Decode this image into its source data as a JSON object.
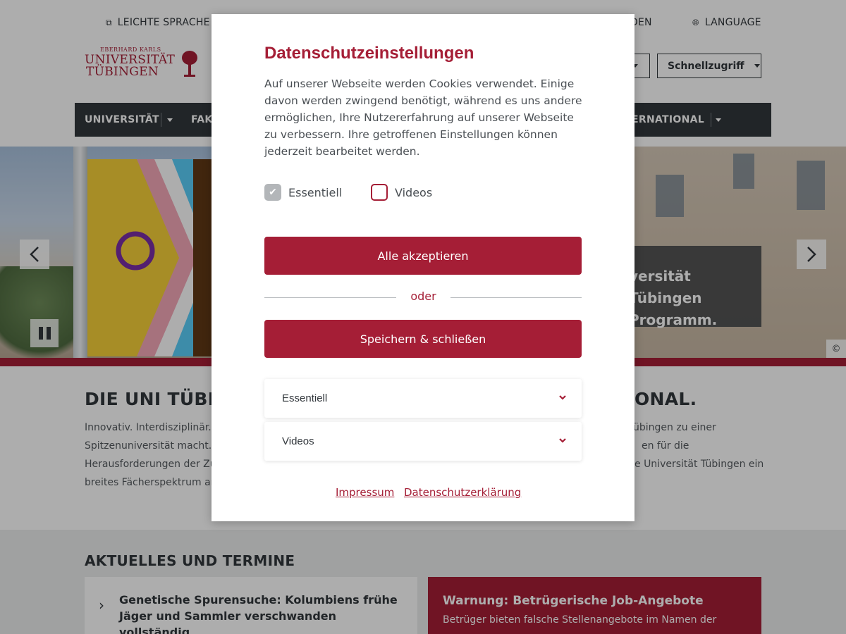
{
  "header": {
    "utility": {
      "easy_language": "LEICHTE SPRACHE",
      "melden": "LDEN",
      "language": "LANGUAGE"
    },
    "logo": {
      "line_small": "EBERHARD KARLS",
      "line1": "UNIVERSITÄT",
      "line2": "TÜBINGEN"
    },
    "quick_access": "Schnellzugriff"
  },
  "nav": {
    "items": [
      "UNIVERSITÄT",
      "FAKU",
      "ERNATIONAL"
    ]
  },
  "hero": {
    "caption_line1": "versität Tübingen",
    "caption_line2": "Programm.",
    "copyright": "©"
  },
  "intro": {
    "title_left": "DIE UNI TÜBIN",
    "title_right": "ONAL.",
    "lines_left": [
      "Innovativ. Interdisziplinär.",
      "Spitzenuniversität macht. D",
      "Herausforderungen der Zu",
      "breites Fächerspektrum an"
    ],
    "lines_right": [
      "übingen zu einer",
      "en für die",
      "e Universität Tübingen ein"
    ]
  },
  "news": {
    "section_title": "AKTUELLES UND TERMINE",
    "card1": "Genetische Spurensuche: Kolumbiens frühe Jäger und Sammler verschwanden vollständig",
    "warning_title": "Warnung: Betrügerische Job-Angebote",
    "warning_text": "Betrüger bieten falsche Stellenangebote im Namen der"
  },
  "modal": {
    "title": "Datenschutzeinstellungen",
    "text_lines": [
      "Auf unserer Webseite werden Cookies verwendet. Einige",
      "davon werden zwingend benötigt, während es uns andere",
      "ermöglichen, Ihre Nutzererfahrung auf unserer Webseite",
      "zu verbessern. Ihre getroffenen Einstellungen können",
      "jederzeit bearbeitet werden."
    ],
    "checkboxes": [
      {
        "label": "Essentiell",
        "checked": true
      },
      {
        "label": "Videos",
        "checked": false
      }
    ],
    "accept_all": "Alle akzeptieren",
    "oder": "oder",
    "save_close": "Speichern & schließen",
    "accordions": [
      "Essentiell",
      "Videos"
    ],
    "impressum": "Impressum",
    "privacy": "Datenschutzerklärung"
  },
  "colors": {
    "brand_red": "#a51e36",
    "dark": "#32373c"
  }
}
